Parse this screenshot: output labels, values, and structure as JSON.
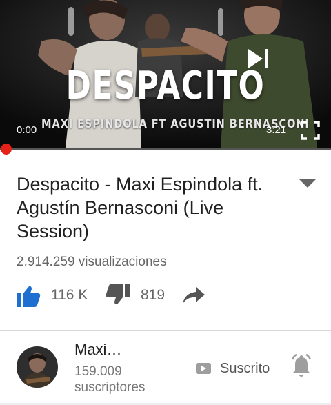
{
  "player": {
    "overlay_title": "DESPACITO",
    "overlay_artists": "MAXI ESPINDOLA  FT  AGUSTIN BERNASCONI",
    "current_time": "0:00",
    "total_time": "3:21",
    "progress": 0,
    "icons": [
      "next-icon",
      "fullscreen-icon"
    ],
    "colors": {
      "progress": "#e62117"
    }
  },
  "video": {
    "title": "Despacito - Maxi Espindola ft. Agustín Bernasconi (Live Session)",
    "views": "2.914.259 visualizaciones",
    "likes": "116 K",
    "dislikes": "819",
    "icons": [
      "thumbs-up-icon",
      "thumbs-down-icon",
      "share-icon",
      "expand-icon"
    ],
    "colors": {
      "like": "#1e6fcf",
      "icon_gray": "#555555"
    }
  },
  "channel": {
    "name": "Maxi…",
    "subscribers": "159.009 suscriptores",
    "subscribe_label": "Suscrito",
    "icons": [
      "avatar",
      "subscription-icon",
      "bell-icon"
    ]
  }
}
